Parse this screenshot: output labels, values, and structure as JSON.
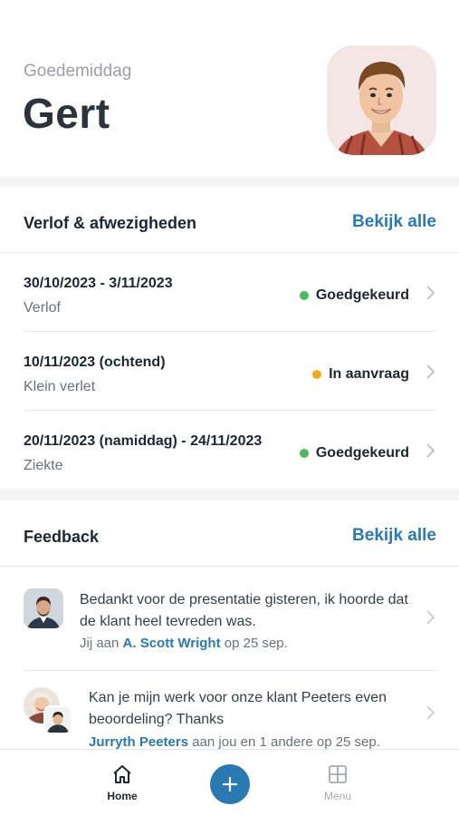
{
  "header": {
    "greeting": "Goedemiddag",
    "user_name": "Gert"
  },
  "leave": {
    "title": "Verlof & afwezigheden",
    "view_all": "Bekijk alle",
    "items": [
      {
        "dates": "30/10/2023 - 3/11/2023",
        "type": "Verlof",
        "status": "Goedgekeurd",
        "status_color": "#4cba5a"
      },
      {
        "dates": "10/11/2023 (ochtend)",
        "type": "Klein verlet",
        "status": "In aanvraag",
        "status_color": "#f2a91e"
      },
      {
        "dates": "20/11/2023 (namiddag) - 24/11/2023",
        "type": "Ziekte",
        "status": "Goedgekeurd",
        "status_color": "#4cba5a"
      }
    ]
  },
  "feedback": {
    "title": "Feedback",
    "view_all": "Bekijk alle",
    "items": [
      {
        "message": "Bedankt voor de presentatie gisteren, ik hoorde dat de klant heel tevreden was.",
        "meta_prefix": "Jij aan",
        "person": "A. Scott Wright",
        "meta_suffix": "op 25 sep."
      },
      {
        "message": "Kan je mijn werk voor onze klant Peeters even beoordeling? Thanks",
        "person": "Jurryth Peeters",
        "meta_suffix": "aan jou en 1 andere op 25 sep."
      }
    ]
  },
  "tabbar": {
    "home": {
      "label": "Home",
      "icon": "home-icon"
    },
    "add": {
      "icon": "plus-icon"
    },
    "menu": {
      "label": "Menu",
      "icon": "grid-icon"
    }
  },
  "colors": {
    "accent": "#2a79b0",
    "approved": "#4cba5a",
    "pending": "#f2a91e"
  }
}
